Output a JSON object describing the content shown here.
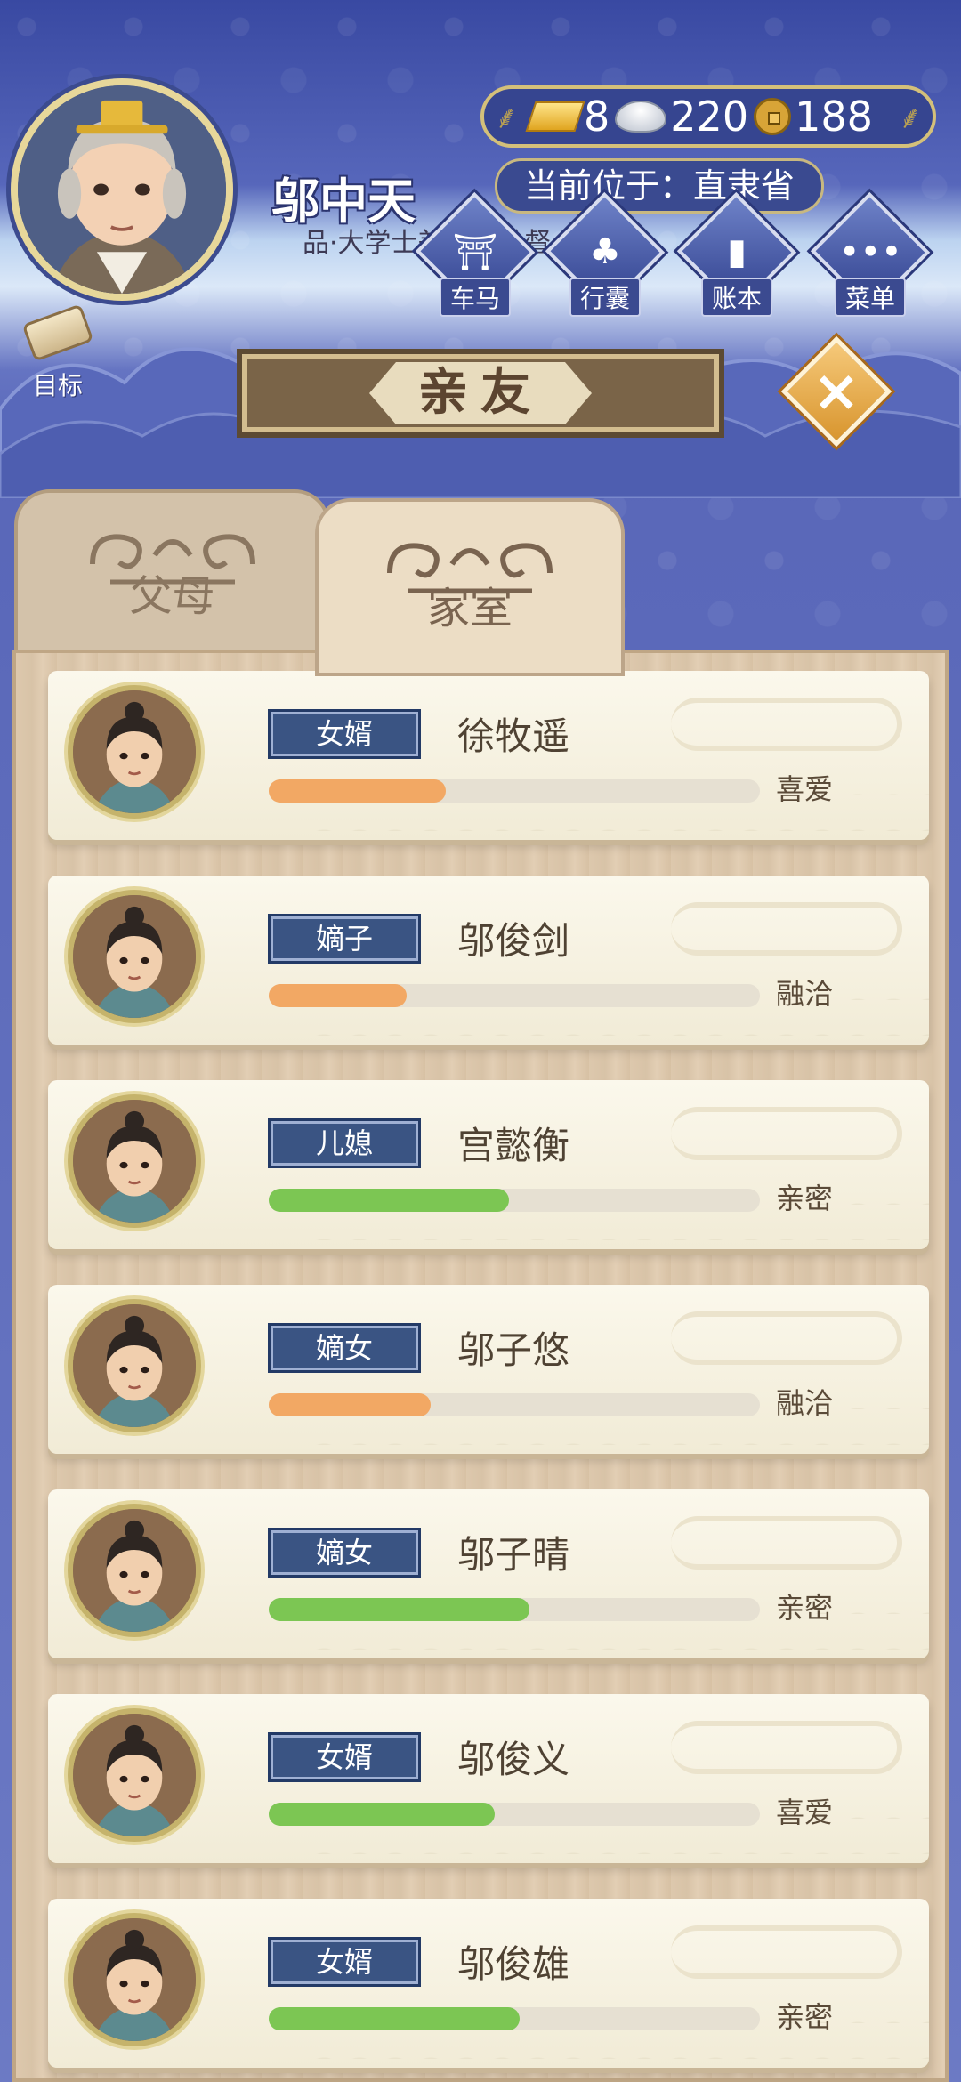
{
  "player": {
    "name": "邬中天",
    "title": "品·大学士兼直隶总督",
    "location_label": "当前位于：直隶省"
  },
  "currency": {
    "gold": "8",
    "silver": "220",
    "coins": "188"
  },
  "menu": [
    {
      "label": "车马",
      "icon": "carriage-icon"
    },
    {
      "label": "行囊",
      "icon": "bundle-icon"
    },
    {
      "label": "账本",
      "icon": "ledger-icon"
    },
    {
      "label": "菜单",
      "icon": "more-icon"
    }
  ],
  "target_label": "目标",
  "panel_title": "亲友",
  "tabs": [
    {
      "label": "父母",
      "active": false
    },
    {
      "label": "家室",
      "active": true
    }
  ],
  "relatives": [
    {
      "role": "女婿",
      "name": "徐牧遥",
      "status": "喜爱",
      "affinity": 0.36,
      "bar_color": "#f2a864"
    },
    {
      "role": "嫡子",
      "name": "邬俊剑",
      "status": "融洽",
      "affinity": 0.28,
      "bar_color": "#f2a864"
    },
    {
      "role": "儿媳",
      "name": "宫懿衡",
      "status": "亲密",
      "affinity": 0.49,
      "bar_color": "#7cc653"
    },
    {
      "role": "嫡女",
      "name": "邬子悠",
      "status": "融洽",
      "affinity": 0.33,
      "bar_color": "#f2a864"
    },
    {
      "role": "嫡女",
      "name": "邬子晴",
      "status": "亲密",
      "affinity": 0.53,
      "bar_color": "#7cc653"
    },
    {
      "role": "女婿",
      "name": "邬俊义",
      "status": "喜爱",
      "affinity": 0.46,
      "bar_color": "#7cc653"
    },
    {
      "role": "女婿",
      "name": "邬俊雄",
      "status": "亲密",
      "affinity": 0.51,
      "bar_color": "#7cc653"
    }
  ]
}
